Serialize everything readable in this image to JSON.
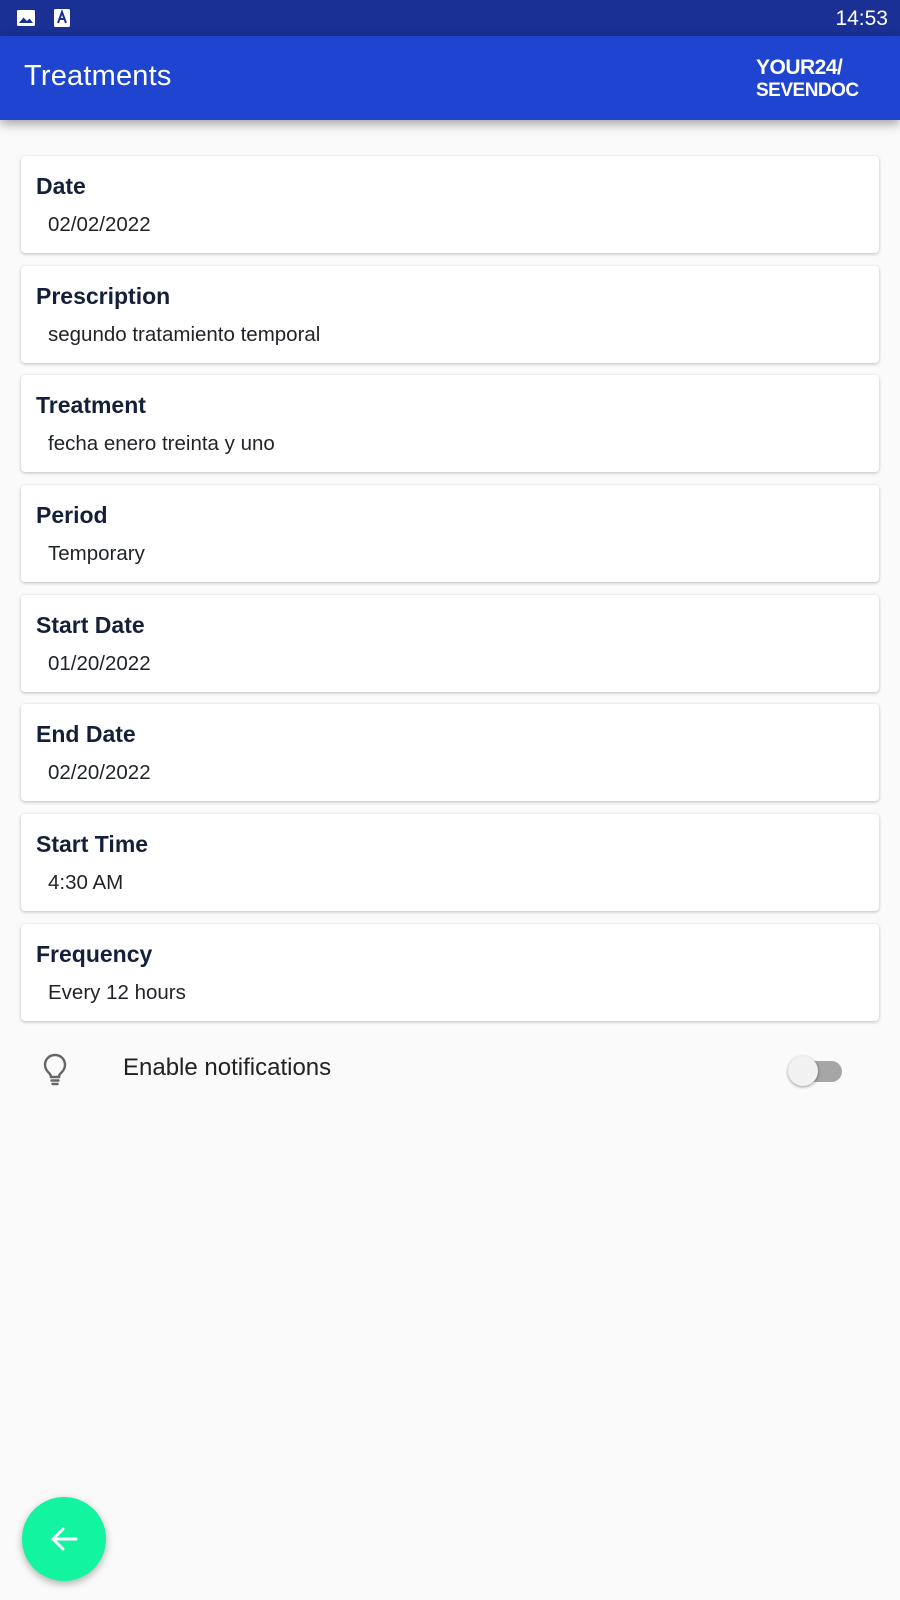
{
  "status_bar": {
    "time": "14:53",
    "icons": [
      "image-icon",
      "text-a-icon"
    ]
  },
  "app_bar": {
    "title": "Treatments",
    "logo": {
      "line1": "YOUR24/",
      "line2": "SEVENDOC"
    }
  },
  "details": [
    {
      "label": "Date",
      "value": "02/02/2022"
    },
    {
      "label": "Prescription",
      "value": "segundo tratamiento temporal"
    },
    {
      "label": "Treatment",
      "value": "fecha enero treinta y uno"
    },
    {
      "label": "Period",
      "value": "Temporary"
    },
    {
      "label": "Start Date",
      "value": "01/20/2022"
    },
    {
      "label": "End Date",
      "value": "02/20/2022"
    },
    {
      "label": "Start Time",
      "value": "4:30 AM"
    },
    {
      "label": "Frequency",
      "value": "Every 12 hours"
    }
  ],
  "notifications": {
    "label": "Enable notifications",
    "enabled": false,
    "icon": "lightbulb-icon"
  },
  "fab": {
    "icon": "arrow-back-icon"
  },
  "colors": {
    "status_bar": "#1a3094",
    "app_bar": "#1f44cf",
    "fab": "#12f49f",
    "background": "#fafafa"
  }
}
